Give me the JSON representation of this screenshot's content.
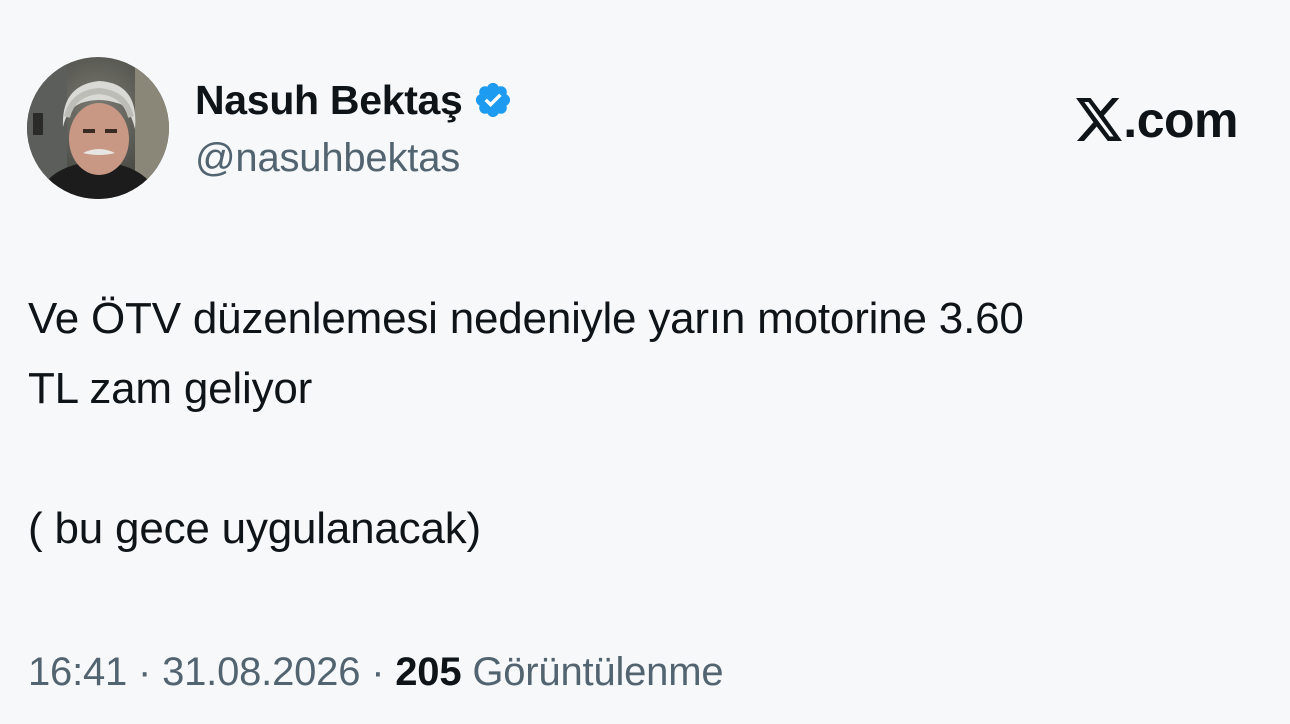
{
  "author": {
    "display_name": "Nasuh Bektaş",
    "handle": "@nasuhbektas",
    "verified": true,
    "verified_color": "#1d9bf0"
  },
  "brand": {
    "logo_icon": "x-logo-icon",
    "text": ".com"
  },
  "tweet": {
    "lines": [
      "Ve ÖTV düzenlemesi nedeniyle yarın motorine 3.60",
      "TL zam geliyor",
      "",
      "( bu gece uygulanacak)"
    ]
  },
  "meta": {
    "time": "16:41",
    "separator": "·",
    "date": "31.08.2026",
    "views_count": "205",
    "views_label": "Görüntülenme"
  },
  "colors": {
    "background": "#f7f8f9",
    "text_primary": "#0f1419",
    "text_secondary": "#536471"
  }
}
